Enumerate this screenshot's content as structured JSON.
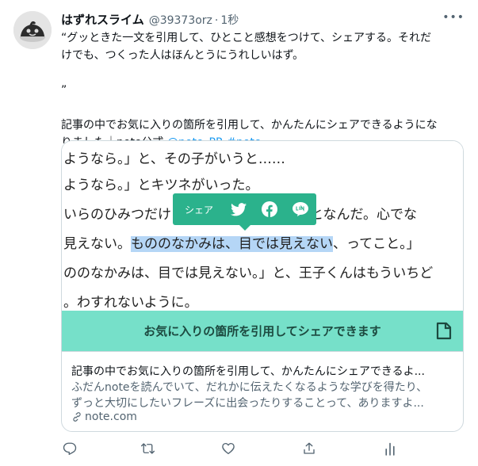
{
  "tweet": {
    "display_name": "はずれスライム",
    "handle": "@39373orz",
    "separator": "·",
    "time": "1秒",
    "more_label": "•••",
    "quote_line1": "“グッときた一文を引用して、ひとこと感想をつけて、シェアする。それだ",
    "quote_line2": "けでも、つくった人はほんとうにうれしいはず。",
    "quote_close": "”",
    "body_line1": "記事の中でお気に入りの箇所を引用して、かんたんにシェアできるようにな",
    "body_line2_prefix": "りました｜note公式 ",
    "mention": "@note_PR",
    "hashtag": "#note"
  },
  "card": {
    "image_lines": [
      "ようなら。」と、その子がいうと……",
      "ようなら。」とキツネがいった。",
      "いらのひみつだけど",
      "んなことなんだ。心でな",
      "見えない。",
      "もののなかみは、目では見えない",
      "、ってこと。」",
      "ののなかみは、目では見えない。」と、王子くんはもういちど",
      "。わすれないように。"
    ],
    "popup_label": "シェア",
    "cta_text": "お気に入りの箇所を引用してシェアできます",
    "accent_color": "#76e0c9",
    "popup_color": "#2bb28c",
    "highlight_color": "#b5d6f6",
    "title": "記事の中でお気に入りの箇所を引用して、かんたんにシェアできるよ...",
    "description_line1": "ふだんnoteを読んでいて、だれかに伝えたくなるような学びを得たり、",
    "description_line2": "ずっと大切にしたいフレーズに出会ったりすることって、ありますよ...",
    "domain": "note.com"
  },
  "icons": {
    "reply": "reply-icon",
    "retweet": "retweet-icon",
    "like": "like-icon",
    "share": "share-icon",
    "analytics": "analytics-icon",
    "link": "link-icon",
    "twitter": "twitter-icon",
    "facebook": "facebook-icon",
    "line": "line-icon",
    "note": "note-icon"
  }
}
